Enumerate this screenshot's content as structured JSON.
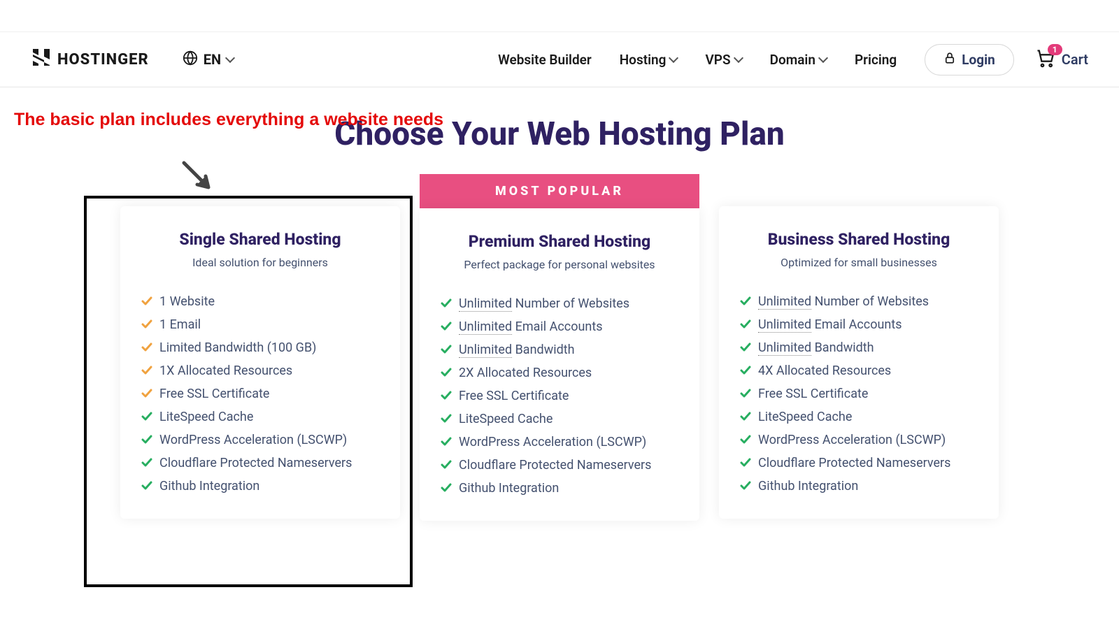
{
  "header": {
    "brand": "HOSTINGER",
    "lang": "EN",
    "nav": {
      "builder": "Website Builder",
      "hosting": "Hosting",
      "vps": "VPS",
      "domain": "Domain",
      "pricing": "Pricing"
    },
    "login": "Login",
    "cart_label": "Cart",
    "cart_count": "1"
  },
  "annotation": "The basic plan includes everything a website needs",
  "page_title": "Choose Your Web Hosting Plan",
  "most_popular_label": "MOST POPULAR",
  "plans": [
    {
      "title": "Single Shared Hosting",
      "subtitle": "Ideal solution for beginners",
      "features": [
        {
          "color": "#f0a23f",
          "pre": "",
          "main": "1 Website"
        },
        {
          "color": "#f0a23f",
          "pre": "",
          "main": "1 Email"
        },
        {
          "color": "#f0a23f",
          "pre": "",
          "main": "Limited Bandwidth (100 GB)"
        },
        {
          "color": "#f0a23f",
          "pre": "",
          "main": "1X Allocated Resources"
        },
        {
          "color": "#f0a23f",
          "pre": "",
          "main": "Free SSL Certificate"
        },
        {
          "color": "#27ae60",
          "pre": "",
          "main": "LiteSpeed Cache"
        },
        {
          "color": "#27ae60",
          "pre": "",
          "main": "WordPress Acceleration (LSCWP)"
        },
        {
          "color": "#27ae60",
          "pre": "",
          "main": "Cloudflare Protected Nameservers"
        },
        {
          "color": "#27ae60",
          "pre": "",
          "main": "Github Integration"
        }
      ]
    },
    {
      "title": "Premium Shared Hosting",
      "subtitle": "Perfect package for personal websites",
      "features": [
        {
          "color": "#27ae60",
          "pre": "Unlimited",
          "main": " Number of Websites"
        },
        {
          "color": "#27ae60",
          "pre": "Unlimited",
          "main": " Email Accounts"
        },
        {
          "color": "#27ae60",
          "pre": "Unlimited",
          "main": " Bandwidth"
        },
        {
          "color": "#27ae60",
          "pre": "",
          "main": "2X Allocated Resources"
        },
        {
          "color": "#27ae60",
          "pre": "",
          "main": "Free SSL Certificate"
        },
        {
          "color": "#27ae60",
          "pre": "",
          "main": "LiteSpeed Cache"
        },
        {
          "color": "#27ae60",
          "pre": "",
          "main": "WordPress Acceleration (LSCWP)"
        },
        {
          "color": "#27ae60",
          "pre": "",
          "main": "Cloudflare Protected Nameservers"
        },
        {
          "color": "#27ae60",
          "pre": "",
          "main": "Github Integration"
        }
      ]
    },
    {
      "title": "Business Shared Hosting",
      "subtitle": "Optimized for small businesses",
      "features": [
        {
          "color": "#27ae60",
          "pre": "Unlimited",
          "main": " Number of Websites"
        },
        {
          "color": "#27ae60",
          "pre": "Unlimited",
          "main": " Email Accounts"
        },
        {
          "color": "#27ae60",
          "pre": "Unlimited",
          "main": " Bandwidth"
        },
        {
          "color": "#27ae60",
          "pre": "",
          "main": "4X Allocated Resources"
        },
        {
          "color": "#27ae60",
          "pre": "",
          "main": "Free SSL Certificate"
        },
        {
          "color": "#27ae60",
          "pre": "",
          "main": "LiteSpeed Cache"
        },
        {
          "color": "#27ae60",
          "pre": "",
          "main": "WordPress Acceleration (LSCWP)"
        },
        {
          "color": "#27ae60",
          "pre": "",
          "main": "Cloudflare Protected Nameservers"
        },
        {
          "color": "#27ae60",
          "pre": "",
          "main": "Github Integration"
        }
      ]
    }
  ]
}
